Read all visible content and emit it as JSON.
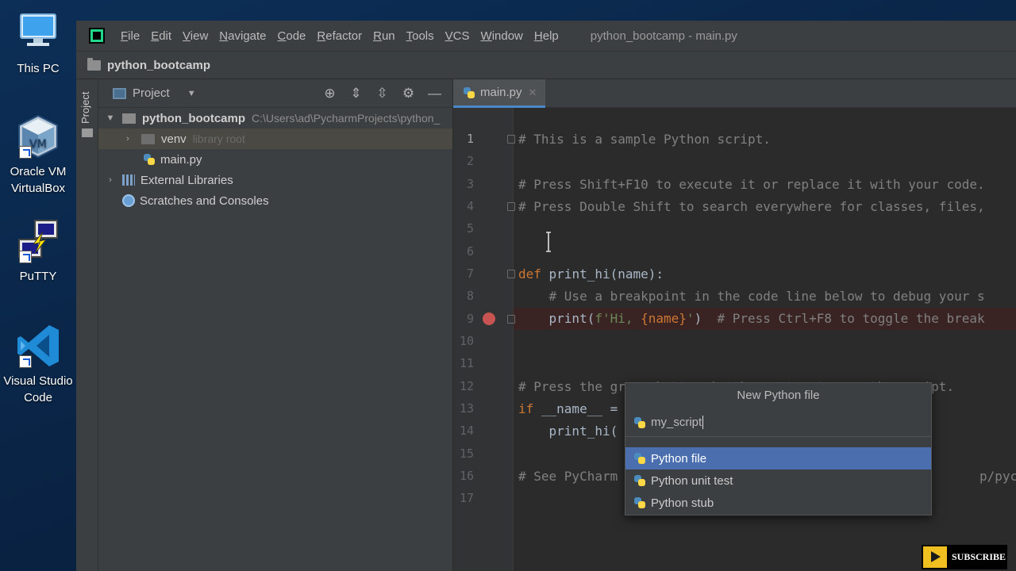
{
  "desktop": {
    "icons": [
      {
        "label": "This PC",
        "icon": "computer-icon"
      },
      {
        "label": "Oracle VM\nVirtualBox",
        "line1": "Oracle VM",
        "line2": "VirtualBox",
        "icon": "virtualbox-icon"
      },
      {
        "label": "PuTTY",
        "icon": "putty-icon"
      },
      {
        "label": "Visual Studio Code",
        "line1": "Visual Studio",
        "line2": "Code",
        "icon": "vscode-icon"
      }
    ]
  },
  "menubar": {
    "items": [
      "File",
      "Edit",
      "View",
      "Navigate",
      "Code",
      "Refactor",
      "Run",
      "Tools",
      "VCS",
      "Window",
      "Help"
    ],
    "window_title": "python_bootcamp - main.py"
  },
  "navbar": {
    "project_name": "python_bootcamp"
  },
  "side_strip": {
    "label": "Project"
  },
  "project_panel": {
    "title": "Project",
    "tree": {
      "root": {
        "label": "python_bootcamp",
        "path": "C:\\Users\\ad\\PycharmProjects\\python_"
      },
      "venv": {
        "label": "venv",
        "hint": "library root"
      },
      "main": {
        "label": "main.py"
      },
      "external": {
        "label": "External Libraries"
      },
      "scratches": {
        "label": "Scratches and Consoles"
      }
    }
  },
  "editor": {
    "tab_label": "main.py",
    "line_numbers": [
      "1",
      "2",
      "3",
      "4",
      "5",
      "6",
      "7",
      "8",
      "9",
      "10",
      "11",
      "12",
      "13",
      "14",
      "15",
      "16",
      "17"
    ],
    "lines": {
      "l1": "# This is a sample Python script.",
      "l3": "# Press Shift+F10 to execute it or replace it with your code.",
      "l4": "# Press Double Shift to search everywhere for classes, files,",
      "l7_kw": "def",
      "l7_rest": " print_hi(name):",
      "l8": "    # Use a breakpoint in the code line below to debug your s",
      "l9_a": "    print(",
      "l9_str1": "f'Hi, ",
      "l9_brace": "{name}",
      "l9_str2": "'",
      "l9_b": ")  ",
      "l9_comment": "# Press Ctrl+F8 to toggle the break",
      "l12": "# Press the green button in the gutter to run the script.",
      "l13_kw": "if",
      "l13_rest": " __name__ =",
      "l14": "    print_hi(",
      "l16_left": "# See PyCharm",
      "l16_right": "p/pycharm/"
    }
  },
  "popup": {
    "title": "New Python file",
    "input_value": "my_script",
    "options": [
      "Python file",
      "Python unit test",
      "Python stub"
    ],
    "selected_index": 0
  },
  "subscribe": {
    "label": "SUBSCRIBE"
  },
  "colors": {
    "keyword": "#cc7832",
    "comment": "#808080",
    "string": "#6a8759",
    "selection": "#4b6eaf",
    "breakpoint": "#c75450"
  }
}
